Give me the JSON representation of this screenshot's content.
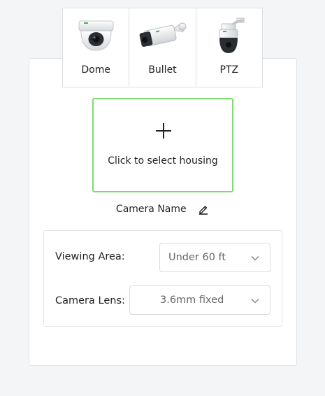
{
  "camera_types": [
    {
      "label": "Dome",
      "icon": "dome-camera-icon"
    },
    {
      "label": "Bullet",
      "icon": "bullet-camera-icon"
    },
    {
      "label": "PTZ",
      "icon": "ptz-camera-icon"
    }
  ],
  "housing": {
    "label": "Click to select housing",
    "icon": "plus-icon",
    "border_color": "#7ddb6f"
  },
  "camera_name": {
    "label": "Camera Name",
    "icon": "pencil-edit-icon"
  },
  "settings": {
    "viewing_area": {
      "label": "Viewing Area:",
      "value": "Under 60 ft"
    },
    "camera_lens": {
      "label": "Camera Lens:",
      "value": "3.6mm fixed"
    }
  }
}
